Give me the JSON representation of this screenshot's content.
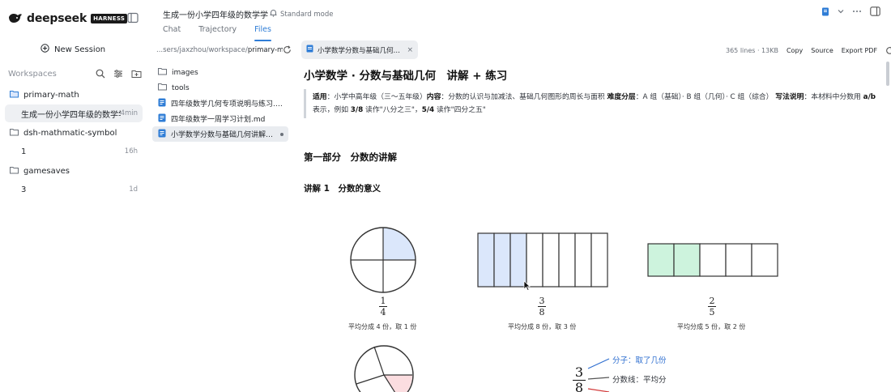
{
  "app": {
    "logo_text": "deepseek",
    "badge": "HARNESS",
    "window_title": "生成一份小学四年级的数学学",
    "mode_label": "Standard mode"
  },
  "sidebar": {
    "new_session_label": "New Session",
    "workspaces_title": "Workspaces",
    "tree": [
      {
        "name": "primary-math",
        "sessions": [
          {
            "label": "生成一份小学四年级的数学学",
            "time": "4min",
            "active": true
          }
        ]
      },
      {
        "name": "dsh-mathmatic-symbol",
        "sessions": [
          {
            "label": "1",
            "time": "16h",
            "active": false
          }
        ]
      },
      {
        "name": "gamesaves",
        "sessions": [
          {
            "label": "3",
            "time": "1d",
            "active": false
          }
        ]
      }
    ]
  },
  "tabs": [
    {
      "label": "Chat",
      "active": false
    },
    {
      "label": "Trajectory",
      "active": false
    },
    {
      "label": "Files",
      "active": true
    }
  ],
  "file_browser": {
    "path_prefix": "...sers/jaxzhou/workspace/",
    "path_current": "primary-math",
    "items": [
      {
        "name": "images",
        "type": "folder",
        "active": false
      },
      {
        "name": "tools",
        "type": "folder",
        "active": false
      },
      {
        "name": "四年级数学几何专项说明与练习.md",
        "type": "file",
        "active": false
      },
      {
        "name": "四年级数学一周学习计划.md",
        "type": "file",
        "active": false
      },
      {
        "name": "小学数学分数与基础几何讲解与...",
        "type": "file",
        "active": true
      }
    ]
  },
  "document": {
    "tab_label": "小学数学分数与基础几何讲解...",
    "meta": "365 lines · 13KB",
    "copy_label": "Copy",
    "source_label": "Source",
    "export_label": "Export PDF",
    "title": "小学数学 · 分数与基础几何　讲解 + 练习",
    "note": {
      "k1": "适用",
      "v1": "：小学中高年级（三～五年级）",
      "k2": "内容",
      "v2": "：分数的认识与加减法、基础几何图形的周长与面积 ",
      "k3": "难度分层",
      "v3": "：A 组（基础）· B 组（几何）· C 组（综合） ",
      "k4": "写法说明",
      "v4": "：本材料中分数用 ",
      "k5": "a/b",
      "v5": " 表示，例如 ",
      "k6": "3/8",
      "v6": " 读作\"八分之三\"，",
      "k7": "5/4",
      "v7": " 读作\"四分之五\""
    },
    "section_title": "第一部分　分数的讲解",
    "lesson_title": "讲解 1　分数的意义",
    "figures": [
      {
        "kind": "circle",
        "num": "1",
        "den": "4",
        "caption": "平均分成 4 份，取 1 份",
        "total": 4,
        "shaded": 1
      },
      {
        "kind": "rect",
        "num": "3",
        "den": "8",
        "caption": "平均分成 8 份，取 3 份",
        "total": 8,
        "shaded": 3
      },
      {
        "kind": "rect",
        "num": "2",
        "den": "5",
        "caption": "平均分成 5 份，取 2 份",
        "total": 5,
        "shaded": 2
      }
    ],
    "anatomy": {
      "num": "3",
      "den": "8",
      "numerator_label": "分子：取了几份",
      "line_label": "分数线：平均分"
    },
    "colors": {
      "blue_fill": "#dbe7fb",
      "green_fill": "#cdf3dd",
      "pink_fill": "#fbdde0",
      "accent": "#2f7dd6"
    }
  }
}
